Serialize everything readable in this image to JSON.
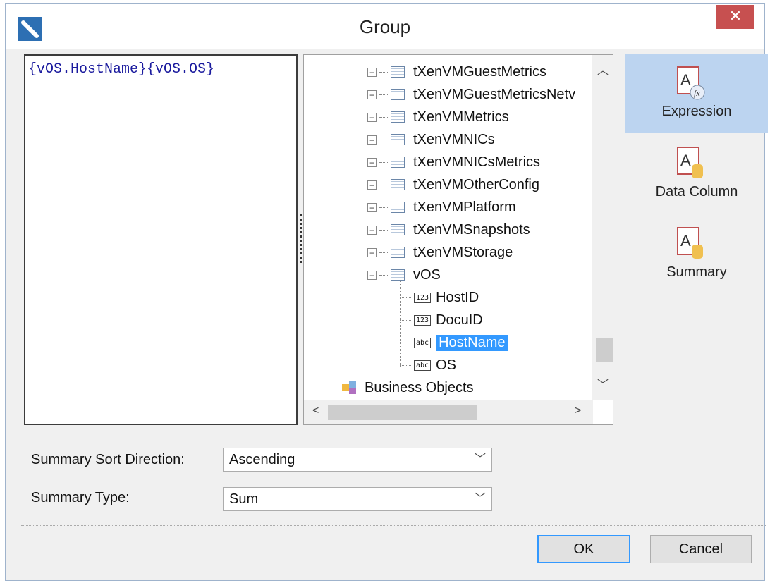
{
  "window": {
    "title": "Group",
    "close_glyph": "✕"
  },
  "expression": {
    "part1": "{vOS.HostName}",
    "part2": "{vOS.OS}"
  },
  "tree": {
    "tables": [
      "tXenVMGuestMetrics",
      "tXenVMGuestMetricsNetv",
      "tXenVMMetrics",
      "tXenVMNICs",
      "tXenVMNICsMetrics",
      "tXenVMOtherConfig",
      "tXenVMPlatform",
      "tXenVMSnapshots",
      "tXenVMStorage"
    ],
    "expanded_table": "vOS",
    "fields": [
      {
        "type": "123",
        "name": "HostID"
      },
      {
        "type": "123",
        "name": "DocuID"
      },
      {
        "type": "abc",
        "name": "HostName",
        "selected": true
      },
      {
        "type": "abc",
        "name": "OS"
      }
    ],
    "business_objects": "Business Objects",
    "plus": "+",
    "minus": "−"
  },
  "side_panel": {
    "items": [
      {
        "label": "Expression",
        "icon": "expression-icon",
        "active": true
      },
      {
        "label": "Data Column",
        "icon": "data-column-icon",
        "active": false
      },
      {
        "label": "Summary",
        "icon": "summary-icon",
        "active": false
      }
    ]
  },
  "form": {
    "sort_direction_label": "Summary Sort Direction:",
    "sort_direction_value": "Ascending",
    "summary_type_label": "Summary Type:",
    "summary_type_value": "Sum"
  },
  "buttons": {
    "ok": "OK",
    "cancel": "Cancel"
  },
  "colors": {
    "selection": "#3399ff",
    "active_panel": "#bcd4f0",
    "close": "#c75050"
  }
}
